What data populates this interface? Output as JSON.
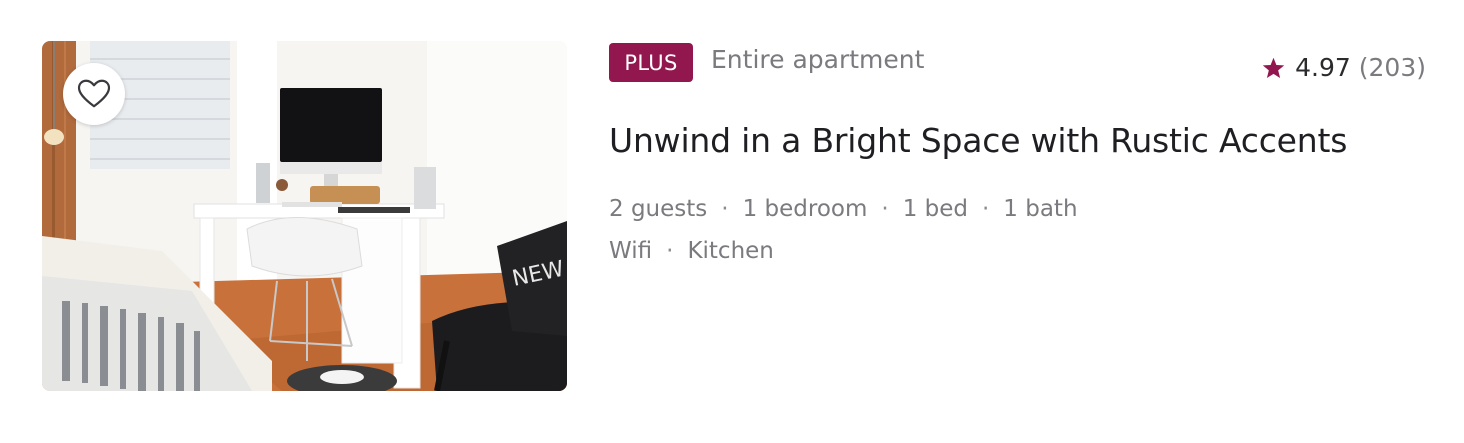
{
  "colors": {
    "brand": "#93174f",
    "text_primary": "#1f1f23",
    "text_secondary": "#7a7a7f"
  },
  "listing": {
    "badge": "PLUS",
    "type": "Entire apartment",
    "rating": {
      "icon": "star-icon",
      "score": "4.97",
      "count": "(203)"
    },
    "title": "Unwind in a Bright Space with Rustic Accents",
    "details": [
      "2 guests",
      "1 bedroom",
      "1 bed",
      "1 bath"
    ],
    "amenities": [
      "Wifi",
      "Kitchen"
    ],
    "separator": "·",
    "favorite_icon": "heart-outline-icon"
  }
}
